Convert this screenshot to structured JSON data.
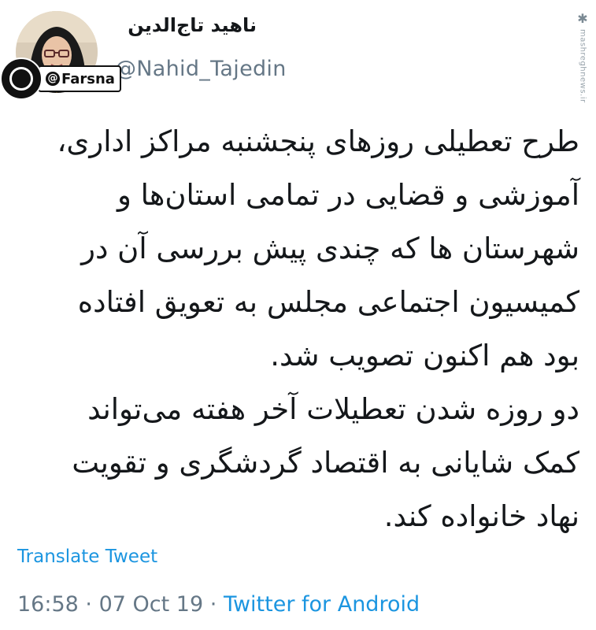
{
  "author": {
    "display_name": "ناهید تاج‌الدین",
    "handle": "@Nahid_Tajedin"
  },
  "watermarks": {
    "farsna_label": "Farsna",
    "side_text": "mashreghnews.ir"
  },
  "tweet": {
    "lines": [
      "طرح تعطیلی روزهای پنجشنبه مراکز اداری،",
      "آموزشی و قضایی در تمامی استان‌ها و",
      "شهرستان ها که چندی پیش بررسی آن در",
      "کمیسیون اجتماعی مجلس به تعویق افتاده",
      "بود هم اکنون تصویب شد.",
      "دو روزه شدن تعطیلات آخر هفته می‌تواند",
      "کمک شایانی به اقتصاد گردشگری و تقویت",
      "نهاد خانواده کند."
    ]
  },
  "actions": {
    "translate_label": "Translate Tweet"
  },
  "meta": {
    "time": "16:58",
    "separator": "·",
    "date": "07 Oct 19",
    "source": "Twitter for Android"
  },
  "colors": {
    "link": "#1b95e0",
    "secondary": "#657786",
    "text": "#14171a"
  }
}
